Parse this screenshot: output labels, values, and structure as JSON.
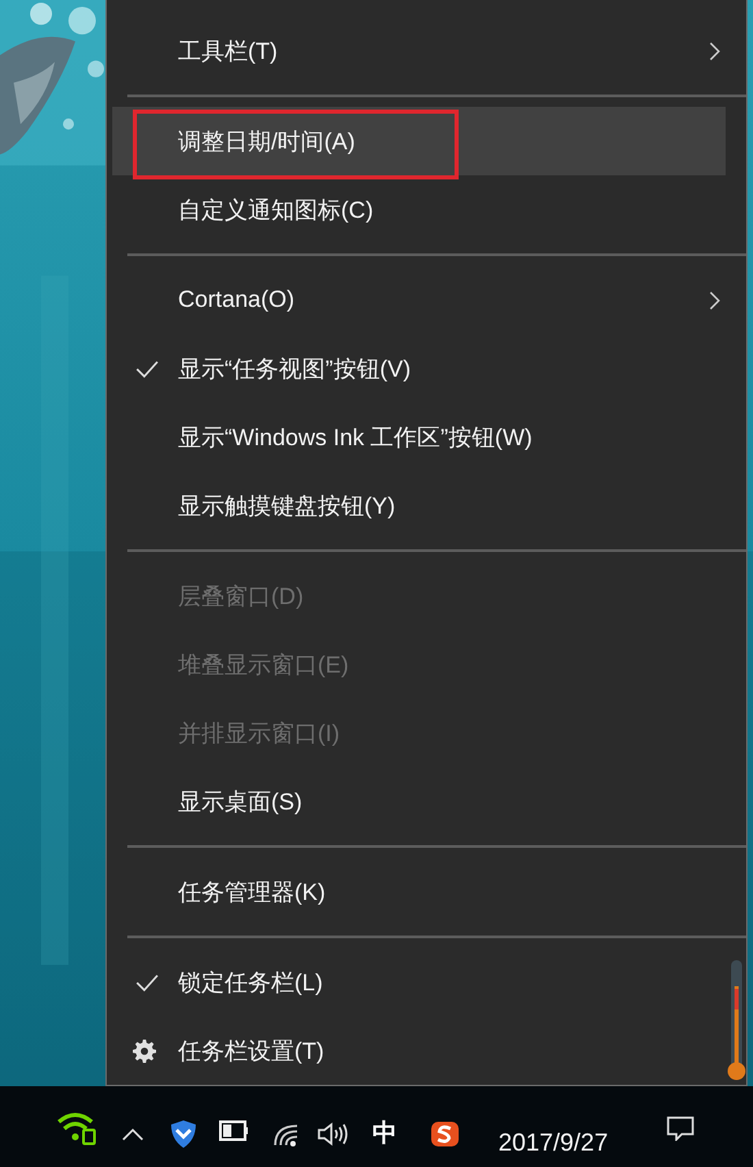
{
  "context_menu": {
    "items": [
      {
        "kind": "item",
        "label": "工具栏(T)",
        "submenu": true,
        "checked": false,
        "disabled": false,
        "selected": false,
        "annotated": false
      },
      {
        "kind": "separator"
      },
      {
        "kind": "item",
        "label": "调整日期/时间(A)",
        "submenu": false,
        "checked": false,
        "disabled": false,
        "selected": true,
        "annotated": true
      },
      {
        "kind": "item",
        "label": "自定义通知图标(C)",
        "submenu": false,
        "checked": false,
        "disabled": false,
        "selected": false,
        "annotated": false
      },
      {
        "kind": "separator"
      },
      {
        "kind": "item",
        "label": "Cortana(O)",
        "submenu": true,
        "checked": false,
        "disabled": false,
        "selected": false,
        "annotated": false
      },
      {
        "kind": "item",
        "label": "显示“任务视图”按钮(V)",
        "submenu": false,
        "checked": true,
        "disabled": false,
        "selected": false,
        "annotated": false
      },
      {
        "kind": "item",
        "label": "显示“Windows Ink 工作区”按钮(W)",
        "submenu": false,
        "checked": false,
        "disabled": false,
        "selected": false,
        "annotated": false
      },
      {
        "kind": "item",
        "label": "显示触摸键盘按钮(Y)",
        "submenu": false,
        "checked": false,
        "disabled": false,
        "selected": false,
        "annotated": false
      },
      {
        "kind": "separator"
      },
      {
        "kind": "item",
        "label": "层叠窗口(D)",
        "submenu": false,
        "checked": false,
        "disabled": true,
        "selected": false,
        "annotated": false
      },
      {
        "kind": "item",
        "label": "堆叠显示窗口(E)",
        "submenu": false,
        "checked": false,
        "disabled": true,
        "selected": false,
        "annotated": false
      },
      {
        "kind": "item",
        "label": "并排显示窗口(I)",
        "submenu": false,
        "checked": false,
        "disabled": true,
        "selected": false,
        "annotated": false
      },
      {
        "kind": "item",
        "label": "显示桌面(S)",
        "submenu": false,
        "checked": false,
        "disabled": false,
        "selected": false,
        "annotated": false
      },
      {
        "kind": "separator"
      },
      {
        "kind": "item",
        "label": "任务管理器(K)",
        "submenu": false,
        "checked": false,
        "disabled": false,
        "selected": false,
        "annotated": false
      },
      {
        "kind": "separator"
      },
      {
        "kind": "item",
        "label": "锁定任务栏(L)",
        "submenu": false,
        "checked": true,
        "disabled": false,
        "selected": false,
        "annotated": false
      },
      {
        "kind": "settings",
        "label": "任务栏设置(T)",
        "submenu": false,
        "checked": false,
        "disabled": false,
        "selected": false,
        "annotated": false
      }
    ]
  },
  "taskbar": {
    "input_indicator": "中",
    "date": "2017/9/27"
  }
}
